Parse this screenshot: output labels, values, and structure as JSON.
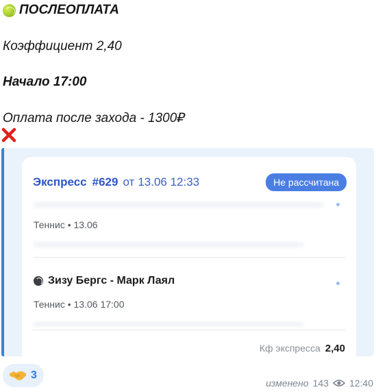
{
  "message": {
    "title": "ПОСЛЕОПЛАТА",
    "coefficient_line": "Коэффициент 2,40",
    "start_line": "Начало 17:00",
    "payment_line": "Оплата после захода - 1300₽"
  },
  "card": {
    "express_label": "Экспресс",
    "express_number": "#629",
    "from_label": "от",
    "datetime": "13.06 12:33",
    "status_badge": "Не рассчитана",
    "first_event_meta": "Теннис • 13.06",
    "second_event_title": "Зизу Бергс - Марк Лаял",
    "second_event_meta": "Теннис • 13.06 17:00",
    "kf_label": "Кф экспресса",
    "kf_value": "2,40"
  },
  "reaction": {
    "count": "3",
    "icon": "handshake-icon"
  },
  "status": {
    "edited": "изменено",
    "views": "143",
    "time": "12:40"
  },
  "colors": {
    "accent": "#3a83d6",
    "badge": "#4a7ee3",
    "link": "#2d55c6"
  }
}
